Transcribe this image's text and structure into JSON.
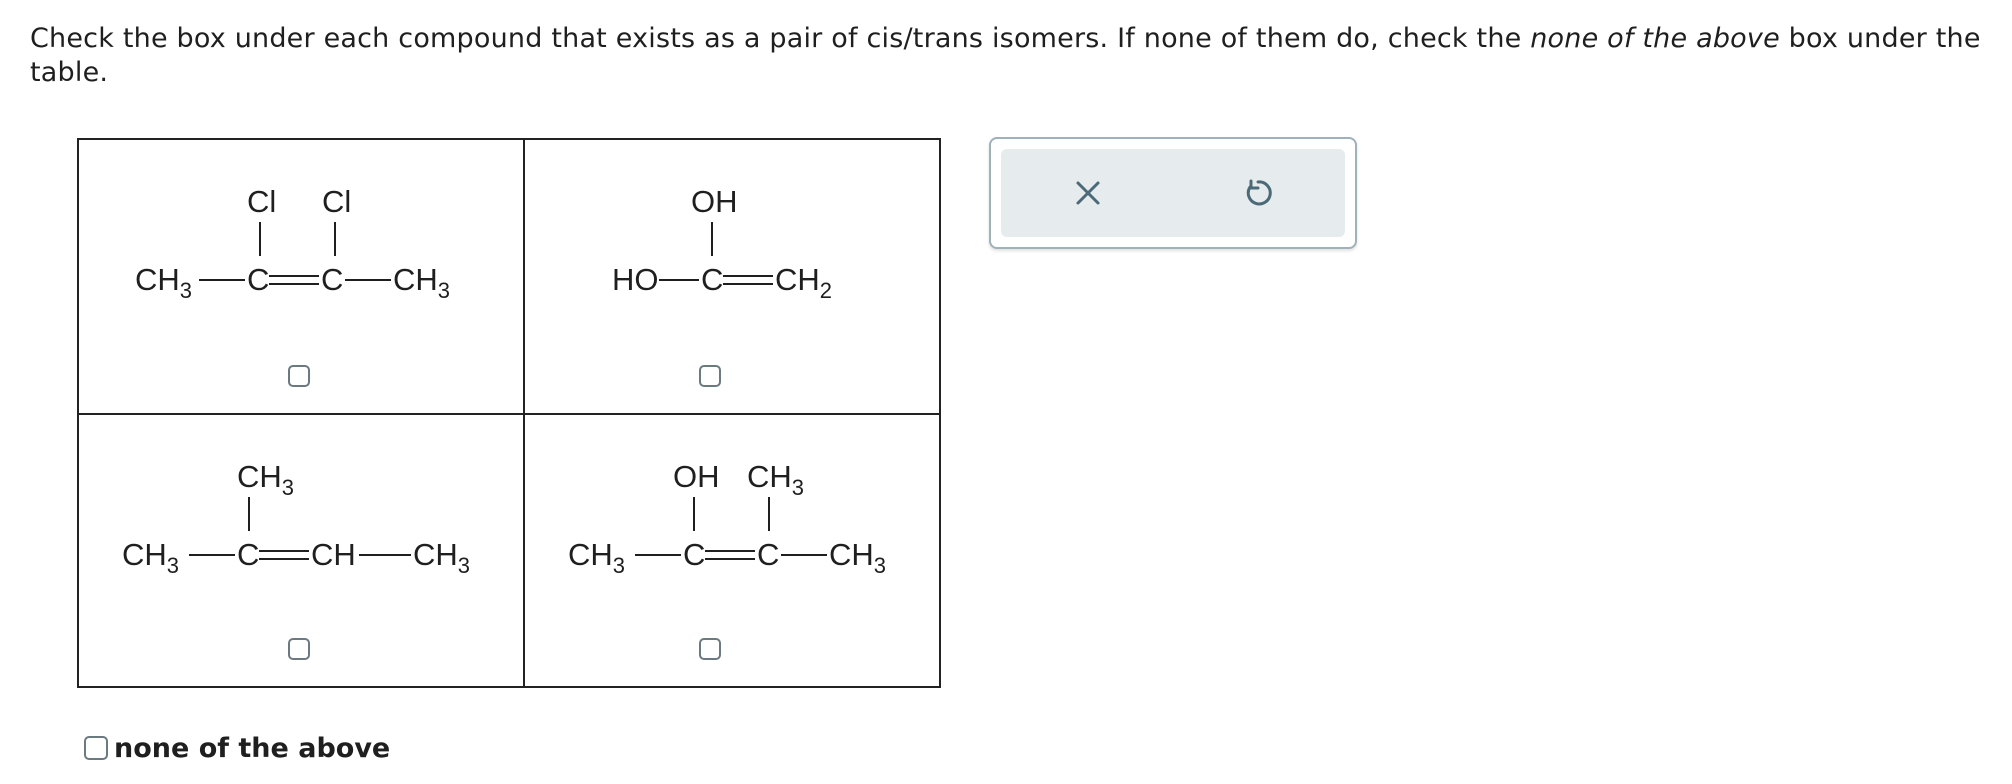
{
  "question": {
    "part1": "Check the box under each compound that exists as a pair of cis/trans isomers. If none of them do, check the ",
    "emphasis": "none of the above",
    "part2": " box under the table."
  },
  "compounds": {
    "c1": {
      "left": "CH",
      "left_sub": "3",
      "sub1": "Cl",
      "sub2": "Cl",
      "c1": "C",
      "c2": "C",
      "right": "CH",
      "right_sub": "3"
    },
    "c2": {
      "left": "HO",
      "top": "OH",
      "c1": "C",
      "right": "CH",
      "right_sub": "2"
    },
    "c3": {
      "left": "CH",
      "left_sub": "3",
      "top": "CH",
      "top_sub": "3",
      "c1": "C",
      "mid": "CH",
      "right": "CH",
      "right_sub": "3"
    },
    "c4": {
      "left": "CH",
      "left_sub": "3",
      "sub1": "OH",
      "sub2": "CH",
      "sub2_sub": "3",
      "c1": "C",
      "c2": "C",
      "right": "CH",
      "right_sub": "3"
    }
  },
  "none_option": {
    "label": "none of the above"
  },
  "toolbar": {
    "clear_icon": "x-icon",
    "undo_icon": "undo-icon",
    "icon_color": "#4a6a78"
  }
}
